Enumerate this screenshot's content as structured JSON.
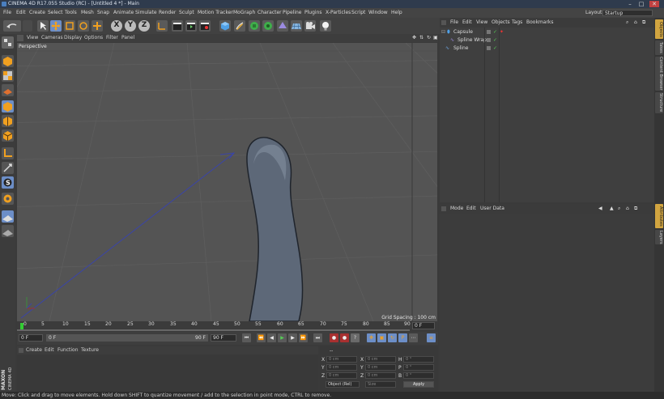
{
  "window": {
    "title": "CINEMA 4D R17.055 Studio (RC) - [Untitled 4 *] - Main",
    "min": "–",
    "max": "□",
    "close": "✕"
  },
  "menu": [
    "File",
    "Edit",
    "Create",
    "Select",
    "Tools",
    "Mesh",
    "Snap",
    "Animate",
    "Simulate",
    "Render",
    "Sculpt",
    "Motion Tracker",
    "MoGraph",
    "Character",
    "Pipeline",
    "Plugins",
    "X-Particles",
    "Script",
    "Window",
    "Help"
  ],
  "layout": {
    "label": "Layout:",
    "value": "Startup"
  },
  "toolbar": {
    "x": "X",
    "y": "Y",
    "z": "Z"
  },
  "viewport": {
    "menu": [
      "View",
      "Cameras",
      "Display",
      "Options",
      "Filter",
      "Panel"
    ],
    "camera": "Perspective",
    "grid_spacing": "Grid Spacing : 100 cm"
  },
  "timeline": {
    "ticks": [
      "0",
      "5",
      "10",
      "15",
      "20",
      "25",
      "30",
      "35",
      "40",
      "45",
      "50",
      "55",
      "60",
      "65",
      "70",
      "75",
      "80",
      "85",
      "90"
    ],
    "end_frame": "0 F"
  },
  "playbar": {
    "current": "0 F",
    "start": "0 F",
    "end_slider": "90 F",
    "max": "90 F"
  },
  "materials": {
    "menu": [
      "Create",
      "Edit",
      "Function",
      "Texture"
    ]
  },
  "coordinates": {
    "header": "--",
    "rows": [
      {
        "axis": "X",
        "pos": "0 cm",
        "size_axis": "X",
        "size": "0 cm",
        "rot_axis": "H",
        "rot": "0 °"
      },
      {
        "axis": "Y",
        "pos": "0 cm",
        "size_axis": "Y",
        "size": "0 cm",
        "rot_axis": "P",
        "rot": "0 °"
      },
      {
        "axis": "Z",
        "pos": "0 cm",
        "size_axis": "Z",
        "size": "0 cm",
        "rot_axis": "B",
        "rot": "0 °"
      }
    ],
    "mode": "Object (Rel)",
    "size_mode": "Size",
    "apply": "Apply"
  },
  "objects": {
    "menu": [
      "File",
      "Edit",
      "View",
      "Objects",
      "Tags",
      "Bookmarks"
    ],
    "items": [
      {
        "name": "Capsule"
      },
      {
        "name": "Spline Wrap"
      },
      {
        "name": "Spline"
      }
    ]
  },
  "attributes": {
    "menu": [
      "Mode",
      "Edit",
      "User Data"
    ]
  },
  "right_tabs": [
    "Objects",
    "Takes",
    "Content Browser",
    "Structure",
    "Attributes",
    "Layers"
  ],
  "status": "Move: Click and drag to move elements. Hold down SHIFT to quantize movement / add to the selection in point mode, CTRL to remove.",
  "brand": {
    "line1": "MAXON",
    "line2": "CINEMA 4D"
  },
  "colors": {
    "accent": "#d2a540",
    "capsule": "#5d6878",
    "spline": "#3a44a8"
  }
}
